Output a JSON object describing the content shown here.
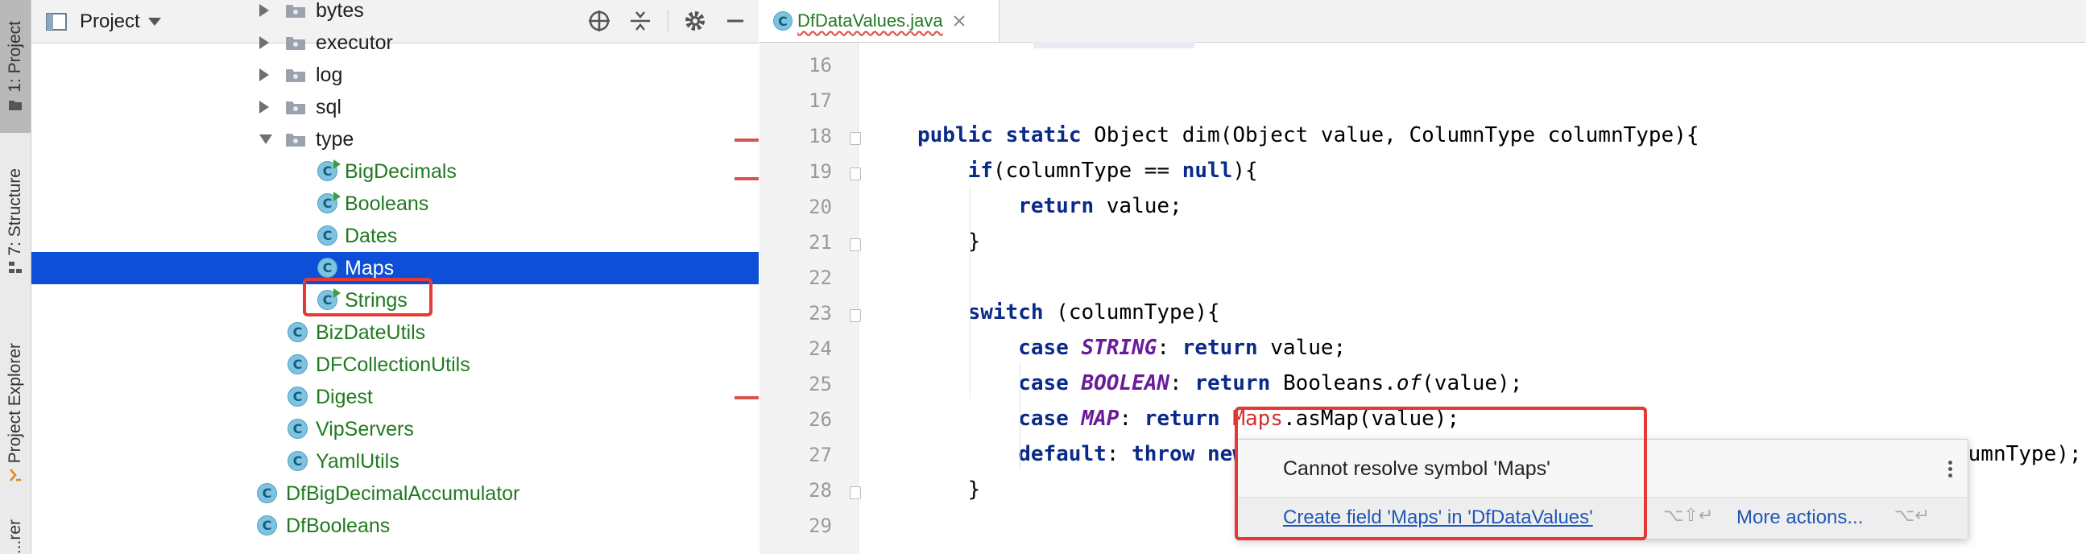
{
  "tool_strip": {
    "project_tab": "1: Project",
    "structure_tab": "7: Structure",
    "explorer_tab": "Project Explorer",
    "cut_tab": "...rer"
  },
  "project_panel": {
    "title": "Project",
    "tree": [
      {
        "label": "bytes",
        "kind": "dir"
      },
      {
        "label": "executor",
        "kind": "dir"
      },
      {
        "label": "log",
        "kind": "dir"
      },
      {
        "label": "sql",
        "kind": "dir"
      },
      {
        "label": "type",
        "kind": "dir-open"
      },
      {
        "label": "BigDecimals",
        "kind": "class-run"
      },
      {
        "label": "Booleans",
        "kind": "class-run"
      },
      {
        "label": "Dates",
        "kind": "class"
      },
      {
        "label": "Maps",
        "kind": "class",
        "selected": true
      },
      {
        "label": "Strings",
        "kind": "class-run"
      },
      {
        "label": "BizDateUtils",
        "kind": "class"
      },
      {
        "label": "DFCollectionUtils",
        "kind": "class"
      },
      {
        "label": "Digest",
        "kind": "class"
      },
      {
        "label": "VipServers",
        "kind": "class"
      },
      {
        "label": "YamlUtils",
        "kind": "class"
      },
      {
        "label": "DfBigDecimalAccumulator",
        "kind": "class"
      },
      {
        "label": "DfBooleans",
        "kind": "class"
      }
    ]
  },
  "editor": {
    "tab_label": "DfDataValues.java",
    "line_numbers": [
      "16",
      "17",
      "18",
      "19",
      "20",
      "21",
      "22",
      "23",
      "24",
      "25",
      "26",
      "27",
      "28",
      "29"
    ],
    "code": {
      "l18_a": "public static ",
      "l18_b": "Object dim(Object value, ColumnType columnType){",
      "l19_a": "if",
      "l19_b": "(columnType == ",
      "l19_c": "null",
      "l19_d": "){",
      "l20_a": "return ",
      "l20_b": "value;",
      "l21": "}",
      "l23_a": "switch ",
      "l23_b": "(columnType){",
      "l24_a": "case ",
      "l24_b": "STRING",
      "l24_c": ": ",
      "l24_d": "return ",
      "l24_e": "value;",
      "l25_a": "case ",
      "l25_b": "BOOLEAN",
      "l25_c": ": ",
      "l25_d": "return ",
      "l25_e": "Booleans.",
      "l25_f": "of",
      "l25_g": "(value);",
      "l26_a": "case ",
      "l26_b": "MAP",
      "l26_c": ": ",
      "l26_d": "return ",
      "l26_e": "Maps",
      "l26_f": ".asMap(value);",
      "l27_a": "default",
      "l27_b": ": ",
      "l27_c": "throw new",
      "l27_tail": "lumnType);",
      "l28": "}"
    }
  },
  "popup": {
    "message": "Cannot resolve symbol 'Maps'",
    "fix_label": "Create field 'Maps' in 'DfDataValues'",
    "fix_keys": "⌥⇧↵",
    "more_label": "More actions...",
    "more_keys": "⌥↵"
  }
}
